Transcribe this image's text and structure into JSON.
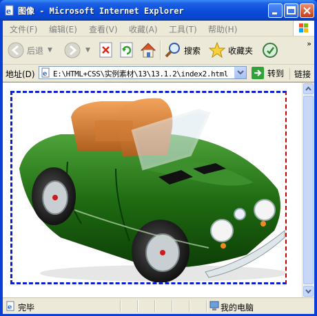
{
  "window": {
    "title": "图像 - Microsoft Internet Explorer"
  },
  "menu": {
    "items": [
      "文件(F)",
      "编辑(E)",
      "查看(V)",
      "收藏(A)",
      "工具(T)",
      "帮助(H)"
    ]
  },
  "toolbar": {
    "back_label": "后退",
    "search_label": "搜索",
    "favorites_label": "收藏夹"
  },
  "address": {
    "label": "地址(D)",
    "url": "E:\\HTML+CSS\\实例素材\\13\\13.1.2\\index2.html",
    "go_label": "转到",
    "links_label": "链接"
  },
  "status": {
    "text": "完毕",
    "zone": "我的电脑"
  },
  "colors": {
    "border_top_left_bottom": "#0a1ecf",
    "border_right": "#c00000"
  }
}
